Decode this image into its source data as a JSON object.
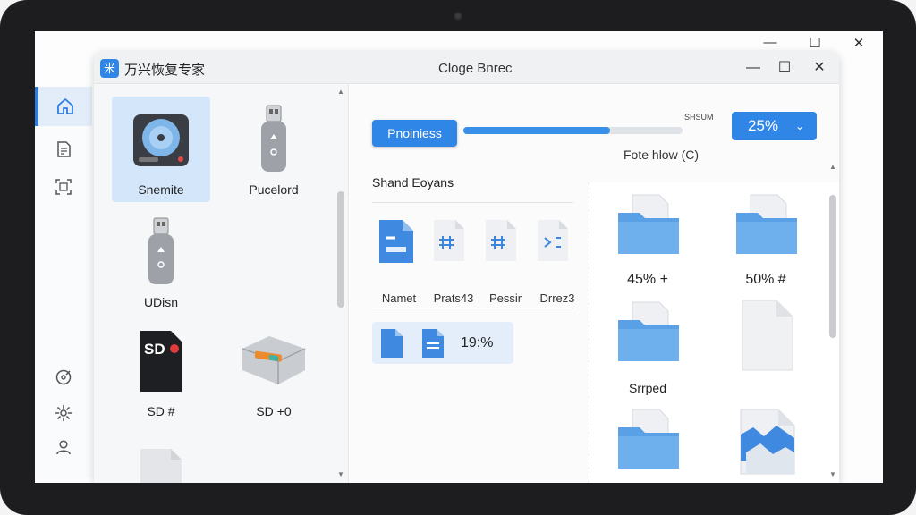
{
  "device": {
    "outer_controls": {
      "minimize": "—",
      "maximize": "☐",
      "close": "✕"
    }
  },
  "sidebar": {
    "items": [
      {
        "icon": "home-icon",
        "active": true
      },
      {
        "icon": "document-icon",
        "active": false
      },
      {
        "icon": "scan-icon",
        "active": false
      },
      {
        "icon": "disc-icon",
        "active": false
      },
      {
        "icon": "gear-icon",
        "active": false
      },
      {
        "icon": "user-icon",
        "active": false
      }
    ]
  },
  "window": {
    "logo_glyph": "米",
    "app_name": "万兴恢复专家",
    "title": "Cloge Bnrec",
    "controls": {
      "minimize": "—",
      "maximize": "☐",
      "close": "✕"
    }
  },
  "devices": [
    {
      "label": "Snemite",
      "icon": "hard-drive-icon",
      "selected": true
    },
    {
      "label": "Pucelord",
      "icon": "usb-drive-icon",
      "selected": false
    },
    {
      "label": "UDisn",
      "icon": "usb-drive-icon",
      "selected": false
    },
    {
      "label": "SD #",
      "icon": "sd-card-icon",
      "selected": false,
      "card_text": "SD"
    },
    {
      "label": "SD +0",
      "icon": "external-drive-icon",
      "selected": false
    }
  ],
  "toolbar": {
    "button_label": "Pnoiniess",
    "progress": 0.67,
    "progress_caption": "SHSUM",
    "percent_value": "25%",
    "sub_text": "Fote  hlow (C)"
  },
  "section": {
    "title": "Shand Eoyans",
    "files": [
      {
        "label": "Namet",
        "icon": "blue-document-icon"
      },
      {
        "label": "Prats43",
        "icon": "code-file-icon"
      },
      {
        "label": "Pessir",
        "icon": "code-file-icon"
      },
      {
        "label": "Drrez3",
        "icon": "code-file-icon"
      }
    ],
    "summary_text": "19:%"
  },
  "grid": [
    {
      "label": "45% +",
      "icon": "folder-icon"
    },
    {
      "label": "50% #",
      "icon": "folder-icon"
    },
    {
      "label": "Srrped",
      "icon": "folder-icon"
    },
    {
      "label": "",
      "icon": "blank-file-icon"
    },
    {
      "label": "",
      "icon": "folder-icon"
    },
    {
      "label": "",
      "icon": "image-file-icon"
    }
  ],
  "colors": {
    "accent": "#2f86e6",
    "selected_bg": "#d4e6f9",
    "folder": "#5aa0e6"
  }
}
